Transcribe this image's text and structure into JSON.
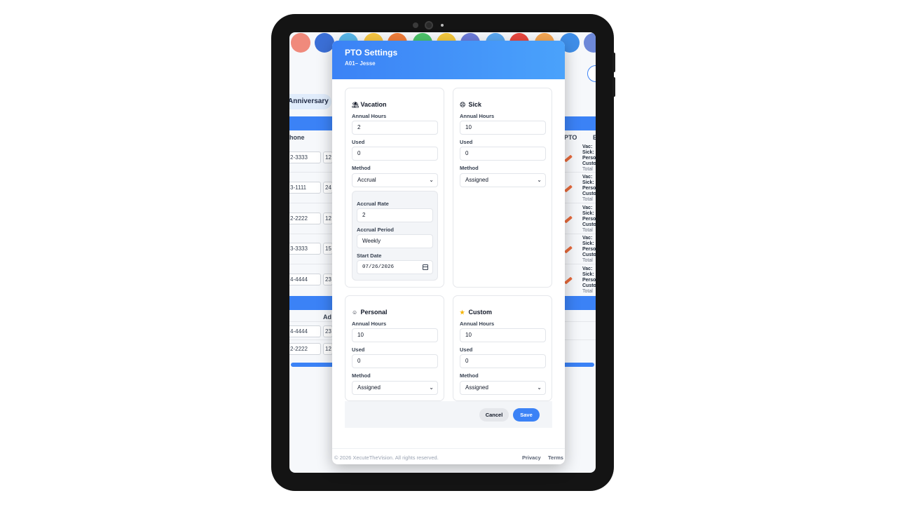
{
  "background_app": {
    "tab_label": "Anniversary",
    "col_phone": "hone",
    "col_pto": "PTO",
    "col_e": "E",
    "col_ad": "Ad",
    "rows": [
      {
        "phone": "2-3333",
        "num": "12"
      },
      {
        "phone": "3-1111",
        "num": "24"
      },
      {
        "phone": "2-2222",
        "num": "12"
      },
      {
        "phone": "3-3333",
        "num": "15"
      },
      {
        "phone": "4-4444",
        "num": "23"
      }
    ],
    "rows2": [
      {
        "phone": "4-4444",
        "num": "23"
      },
      {
        "phone": "2-2222",
        "num": "12"
      }
    ],
    "pto_lines": [
      "Vac:",
      "Sick:",
      "Perso",
      "Custo",
      "Total"
    ]
  },
  "modal": {
    "title": "PTO Settings",
    "subtitle": "A01– Jesse",
    "vacation": {
      "title": "Vacation",
      "icon": "beach-umbrella-icon",
      "annual_label": "Annual Hours",
      "annual_value": "2",
      "used_label": "Used",
      "used_value": "0",
      "method_label": "Method",
      "method_value": "Accrual",
      "accrual_rate_label": "Accrual Rate",
      "accrual_rate_value": "2",
      "accrual_period_label": "Accrual Period",
      "accrual_period_value": "Weekly",
      "start_date_label": "Start Date",
      "start_date_value": "07/26/2026"
    },
    "sick": {
      "title": "Sick",
      "icon": "sick-face-icon",
      "annual_label": "Annual Hours",
      "annual_value": "10",
      "used_label": "Used",
      "used_value": "0",
      "method_label": "Method",
      "method_value": "Assigned"
    },
    "personal": {
      "title": "Personal",
      "icon": "person-icon",
      "annual_label": "Annual Hours",
      "annual_value": "10",
      "used_label": "Used",
      "used_value": "0",
      "method_label": "Method",
      "method_value": "Assigned"
    },
    "custom": {
      "title": "Custom",
      "icon": "star-icon",
      "annual_label": "Annual Hours",
      "annual_value": "10",
      "used_label": "Used",
      "used_value": "0",
      "method_label": "Method",
      "method_value": "Assigned"
    },
    "cancel_label": "Cancel",
    "save_label": "Save",
    "copyright": "© 2026 XecuteTheVision. All rights reserved.",
    "privacy": "Privacy",
    "terms": "Terms"
  },
  "colors": {
    "accent": "#3b82f6",
    "frame": "#141414"
  }
}
